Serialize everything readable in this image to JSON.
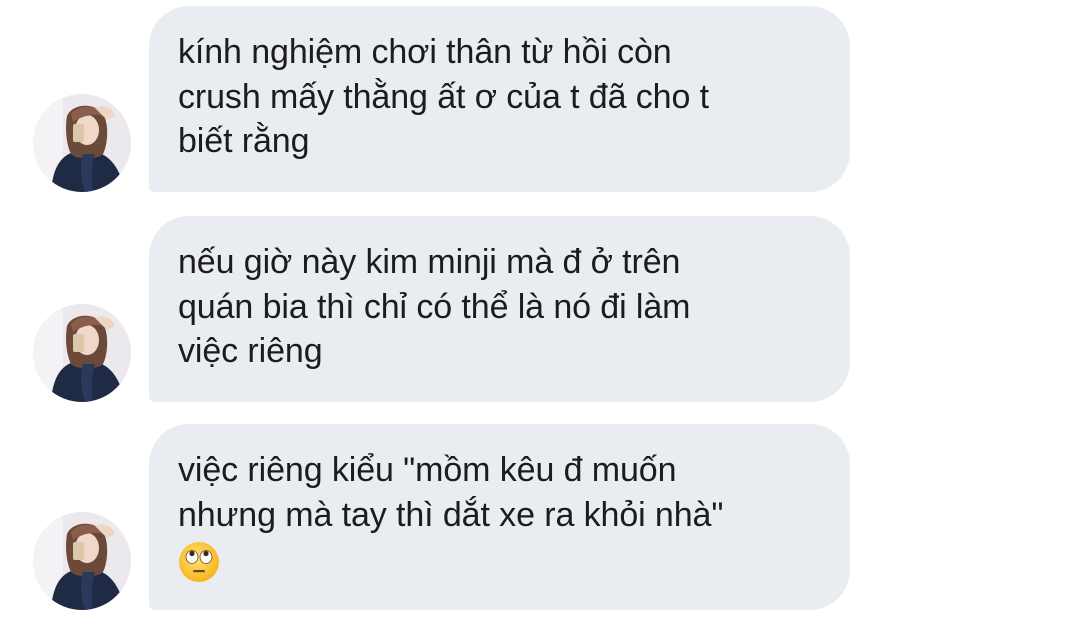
{
  "thread": {
    "messages": [
      {
        "text": "kính nghiệm chơi thân từ hồi còn\ncrush mấy thằng ất ơ của t đã cho t\nbiết rằng",
        "emoji": ""
      },
      {
        "text": "nếu giờ này kim minji mà đ ở trên\nquán bia thì chỉ có thể là nó đi làm\nviệc riêng",
        "emoji": ""
      },
      {
        "text": "việc riêng kiểu \"mồm kêu đ muốn\nnhưng mà tay thì dắt xe ra khỏi nhà\"",
        "emoji": "face-with-rolling-eyes"
      }
    ]
  },
  "colors": {
    "bubble": "#e9edf2",
    "text": "#1c1c1c",
    "background": "#ffffff"
  }
}
